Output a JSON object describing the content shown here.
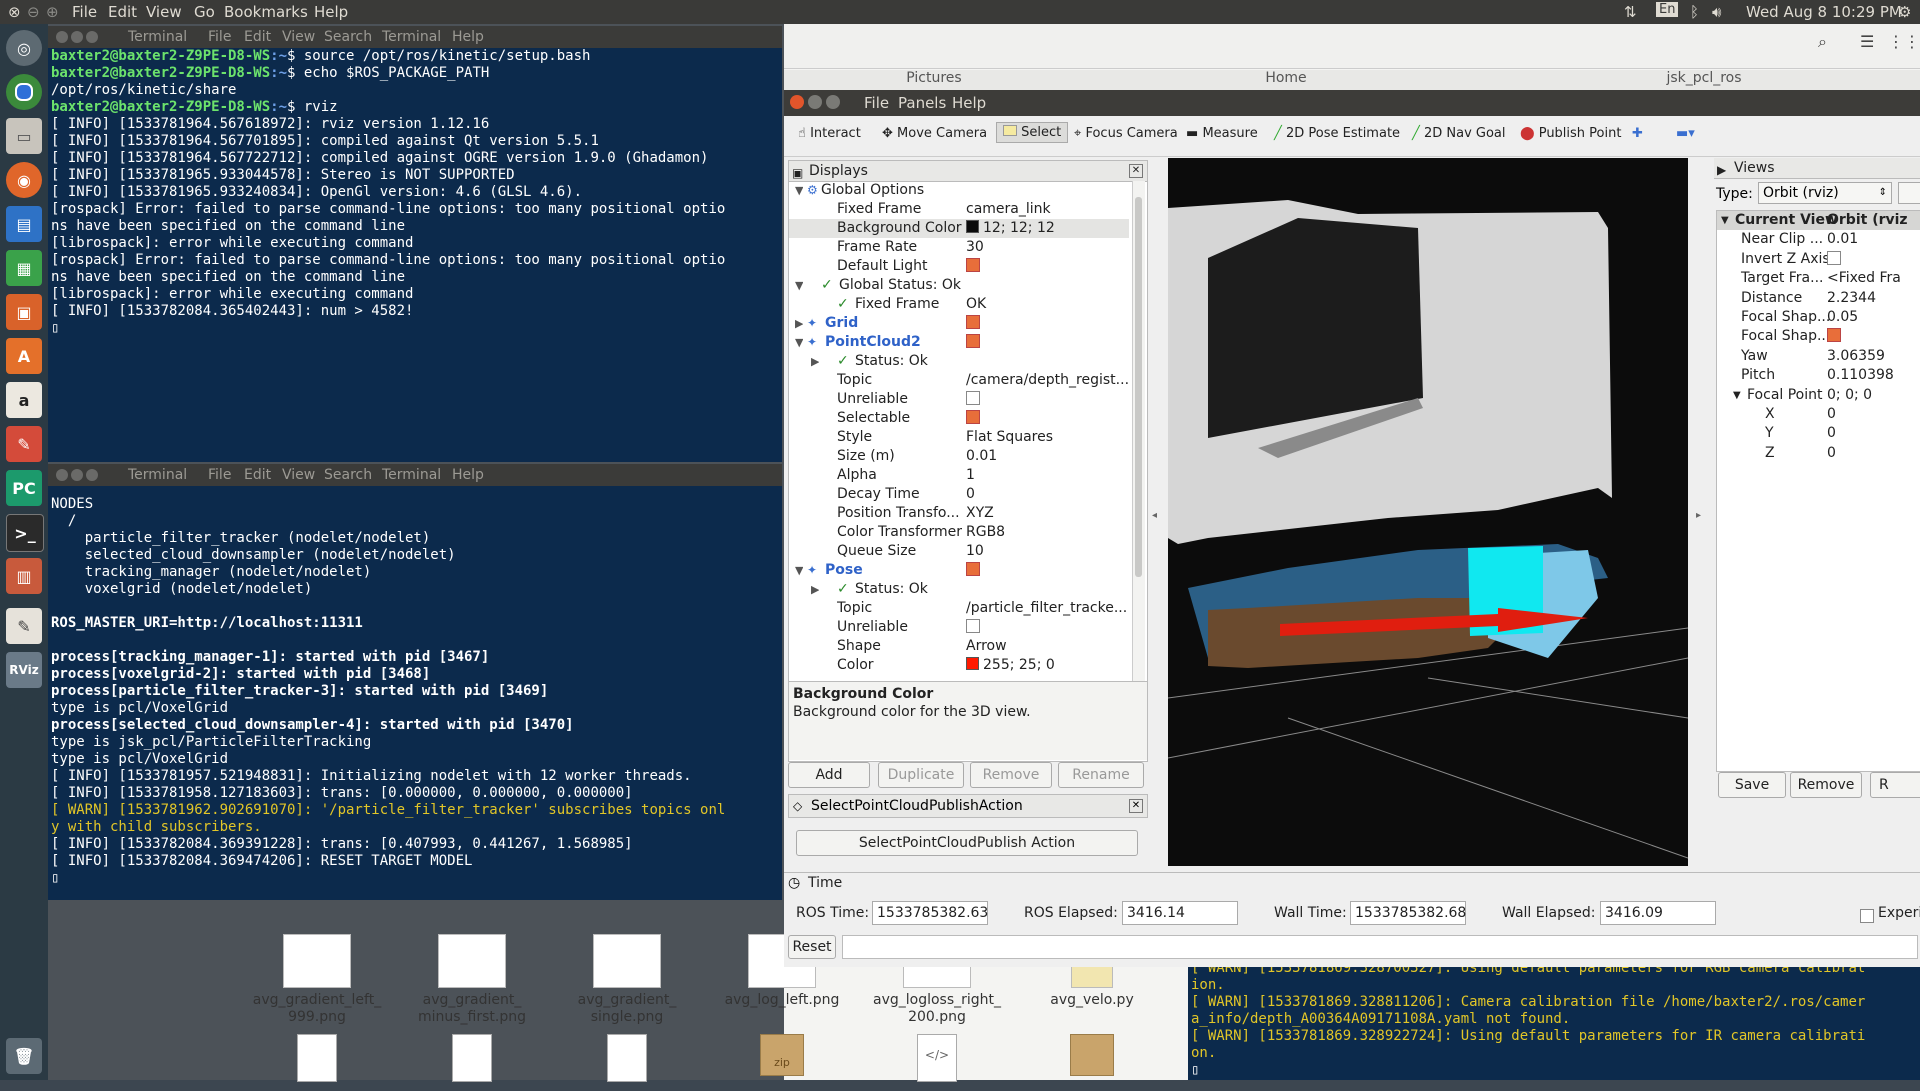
{
  "topbar": {
    "menus": [
      "File",
      "Edit",
      "View",
      "Go",
      "Bookmarks",
      "Help"
    ],
    "lang": "En",
    "clock": "Wed Aug  8 10:29 PM"
  },
  "launcher": {
    "icons": [
      "dash-icon",
      "chrome-icon",
      "files-icon",
      "firefox-icon",
      "writer-icon",
      "calc-icon",
      "impress-icon",
      "software-center-icon",
      "amazon-icon",
      "settings-icon",
      "pycharm-icon",
      "terminal-icon",
      "system-monitor-icon",
      "text-editor-icon",
      "rviz-icon",
      "trash-icon"
    ]
  },
  "filemanager": {
    "tabs": [
      "Pictures",
      "Home",
      "jsk_pcl_ros"
    ],
    "files": [
      {
        "name": "avg_gradient_left_\n999.png",
        "kind": "thumb"
      },
      {
        "name": "avg_gradient_\nminus_first.png",
        "kind": "thumb"
      },
      {
        "name": "avg_gradient_\nsingle.png",
        "kind": "thumb"
      },
      {
        "name": "avg_log_left.png",
        "kind": "thumb"
      },
      {
        "name": "avg_logloss_right_\n200.png",
        "kind": "thumb"
      },
      {
        "name": "avg_velo.py",
        "kind": "doc"
      }
    ],
    "zip_label": "zip"
  },
  "terminal1": {
    "title": "Terminal",
    "menus": [
      "Terminal",
      "File",
      "Edit",
      "View",
      "Search",
      "Terminal",
      "Help"
    ],
    "lines": [
      {
        "p": "baxter2@baxter2-Z9PE-D8-WS",
        "c": "source /opt/ros/kinetic/setup.bash"
      },
      {
        "p": "baxter2@baxter2-Z9PE-D8-WS",
        "c": "echo $ROS_PACKAGE_PATH"
      },
      {
        "t": "/opt/ros/kinetic/share"
      },
      {
        "p": "baxter2@baxter2-Z9PE-D8-WS",
        "c": "rviz"
      },
      {
        "t": "[ INFO] [1533781964.567618972]: rviz version 1.12.16"
      },
      {
        "t": "[ INFO] [1533781964.567701895]: compiled against Qt version 5.5.1"
      },
      {
        "t": "[ INFO] [1533781964.567722712]: compiled against OGRE version 1.9.0 (Ghadamon)"
      },
      {
        "t": "[ INFO] [1533781965.933044578]: Stereo is NOT SUPPORTED"
      },
      {
        "t": "[ INFO] [1533781965.933240834]: OpenGl version: 4.6 (GLSL 4.6)."
      },
      {
        "t": "[rospack] Error: failed to parse command-line options: too many positional optio"
      },
      {
        "t": "ns have been specified on the command line"
      },
      {
        "t": "[librospack]: error while executing command"
      },
      {
        "t": "[rospack] Error: failed to parse command-line options: too many positional optio"
      },
      {
        "t": "ns have been specified on the command line"
      },
      {
        "t": "[librospack]: error while executing command"
      },
      {
        "t": "[ INFO] [1533782084.365402443]: num > 4582!"
      }
    ]
  },
  "terminal2": {
    "menus": [
      "Terminal",
      "File",
      "Edit",
      "View",
      "Search",
      "Terminal",
      "Help"
    ],
    "lines": [
      {
        "t": "NODES"
      },
      {
        "t": "  /"
      },
      {
        "t": "    particle_filter_tracker (nodelet/nodelet)"
      },
      {
        "t": "    selected_cloud_downsampler (nodelet/nodelet)"
      },
      {
        "t": "    tracking_manager (nodelet/nodelet)"
      },
      {
        "t": "    voxelgrid (nodelet/nodelet)"
      },
      {
        "t": ""
      },
      {
        "t": "ROS_MASTER_URI=http://localhost:11311",
        "s": "bold"
      },
      {
        "t": ""
      },
      {
        "t": "process[tracking_manager-1]: started with pid [3467]",
        "s": "bold"
      },
      {
        "t": "process[voxelgrid-2]: started with pid [3468]",
        "s": "bold"
      },
      {
        "t": "process[particle_filter_tracker-3]: started with pid [3469]",
        "s": "bold"
      },
      {
        "t": "type is pcl/VoxelGrid"
      },
      {
        "t": "process[selected_cloud_downsampler-4]: started with pid [3470]",
        "s": "bold"
      },
      {
        "t": "type is jsk_pcl/ParticleFilterTracking"
      },
      {
        "t": "type is pcl/VoxelGrid"
      },
      {
        "t": "[ INFO] [1533781957.521948831]: Initializing nodelet with 12 worker threads."
      },
      {
        "t": "[ INFO] [1533781958.127183603]: trans: [0.000000, 0.000000, 0.000000]"
      },
      {
        "t": "[ WARN] [1533781962.902691070]: '/particle_filter_tracker' subscribes topics onl",
        "s": "y"
      },
      {
        "t": "y with child subscribers.",
        "s": "y"
      },
      {
        "t": "[ INFO] [1533782084.369391228]: trans: [0.407993, 0.441267, 1.568985]"
      },
      {
        "t": "[ INFO] [1533782084.369474206]: RESET TARGET MODEL"
      }
    ]
  },
  "terminal3": {
    "lines": [
      {
        "t": "[ WARN] [1533781869.328700327]: Using default parameters for RGB camera calibrat",
        "s": "y"
      },
      {
        "t": "ion.",
        "s": "y"
      },
      {
        "t": "[ WARN] [1533781869.328811206]: Camera calibration file /home/baxter2/.ros/camer",
        "s": "y"
      },
      {
        "t": "a_info/depth_A00364A09171108A.yaml not found.",
        "s": "y"
      },
      {
        "t": "[ WARN] [1533781869.328922724]: Using default parameters for IR camera calibrati",
        "s": "y"
      },
      {
        "t": "on.",
        "s": "y"
      }
    ]
  },
  "rviz": {
    "menus": [
      "File",
      "Panels",
      "Help"
    ],
    "tools": [
      "Interact",
      "Move Camera",
      "Select",
      "Focus Camera",
      "Measure",
      "2D Pose Estimate",
      "2D Nav Goal",
      "Publish Point"
    ],
    "displays_title": "Displays",
    "rows": [
      {
        "k": "Global Options",
        "v": "",
        "ind": 0,
        "tri": "▼",
        "icon": "gear"
      },
      {
        "k": "Fixed Frame",
        "v": "camera_link",
        "ind": 1
      },
      {
        "k": "Background Color",
        "v": "12; 12; 12",
        "ind": 1,
        "sw": "#0c0c0c",
        "sel": true
      },
      {
        "k": "Frame Rate",
        "v": "30",
        "ind": 1
      },
      {
        "k": "Default Light",
        "v": "",
        "ind": 1,
        "chk": true
      },
      {
        "k": "Global Status: Ok",
        "v": "",
        "ind": 0,
        "tri": "▼",
        "ok": true
      },
      {
        "k": "Fixed Frame",
        "v": "OK",
        "ind": 1,
        "ok": true
      },
      {
        "k": "Grid",
        "v": "",
        "ind": 0,
        "tri": "▶",
        "chk": true,
        "blue": true
      },
      {
        "k": "PointCloud2",
        "v": "",
        "ind": 0,
        "tri": "▼",
        "chk": true,
        "blue": true
      },
      {
        "k": "Status: Ok",
        "v": "",
        "ind": 1,
        "tri": "▶",
        "ok": true
      },
      {
        "k": "Topic",
        "v": "/camera/depth_regist...",
        "ind": 1
      },
      {
        "k": "Unreliable",
        "v": "",
        "ind": 1,
        "chk": false
      },
      {
        "k": "Selectable",
        "v": "",
        "ind": 1,
        "chk": true
      },
      {
        "k": "Style",
        "v": "Flat Squares",
        "ind": 1
      },
      {
        "k": "Size (m)",
        "v": "0.01",
        "ind": 1
      },
      {
        "k": "Alpha",
        "v": "1",
        "ind": 1
      },
      {
        "k": "Decay Time",
        "v": "0",
        "ind": 1
      },
      {
        "k": "Position Transfo...",
        "v": "XYZ",
        "ind": 1
      },
      {
        "k": "Color Transformer",
        "v": "RGB8",
        "ind": 1
      },
      {
        "k": "Queue Size",
        "v": "10",
        "ind": 1
      },
      {
        "k": "Pose",
        "v": "",
        "ind": 0,
        "tri": "▼",
        "chk": true,
        "blue": true
      },
      {
        "k": "Status: Ok",
        "v": "",
        "ind": 1,
        "tri": "▶",
        "ok": true
      },
      {
        "k": "Topic",
        "v": "/particle_filter_tracke...",
        "ind": 1
      },
      {
        "k": "Unreliable",
        "v": "",
        "ind": 1,
        "chk": false
      },
      {
        "k": "Shape",
        "v": "Arrow",
        "ind": 1
      },
      {
        "k": "Color",
        "v": "255; 25; 0",
        "ind": 1,
        "sw": "#ff1900"
      }
    ],
    "desc_title": "Background Color",
    "desc_text": "Background color for the 3D view.",
    "buttons": {
      "add": "Add",
      "duplicate": "Duplicate",
      "remove": "Remove",
      "rename": "Rename"
    },
    "select_panel_title": "SelectPointCloudPublishAction",
    "select_button": "SelectPointCloudPublish Action",
    "views_title": "Views",
    "type_label": "Type:",
    "type_value": "Orbit (rviz)",
    "views_header_k": "Current View",
    "views_header_v": "Orbit (rviz",
    "views_rows": [
      {
        "k": "Near Clip ...",
        "v": "0.01"
      },
      {
        "k": "Invert Z Axis",
        "v": ""
      },
      {
        "k": "Target Fra...",
        "v": "<Fixed Fra"
      },
      {
        "k": "Distance",
        "v": "2.2344"
      },
      {
        "k": "Focal Shap...",
        "v": "0.05"
      },
      {
        "k": "Focal Shap...",
        "v": ""
      },
      {
        "k": "Yaw",
        "v": "3.06359"
      },
      {
        "k": "Pitch",
        "v": "0.110398"
      },
      {
        "k": "Focal Point",
        "v": "0; 0; 0"
      },
      {
        "k": "X",
        "v": "0"
      },
      {
        "k": "Y",
        "v": "0"
      },
      {
        "k": "Z",
        "v": "0"
      }
    ],
    "views_buttons": {
      "save": "Save",
      "remove": "Remove",
      "rename": "R"
    },
    "time_title": "Time",
    "ros_time_label": "ROS Time:",
    "ros_time": "1533785382.63",
    "ros_elapsed_label": "ROS Elapsed:",
    "ros_elapsed": "3416.14",
    "wall_time_label": "Wall Time:",
    "wall_time": "1533785382.68",
    "wall_elapsed_label": "Wall Elapsed:",
    "wall_elapsed": "3416.09",
    "experimental": "Experi",
    "reset": "Reset"
  }
}
